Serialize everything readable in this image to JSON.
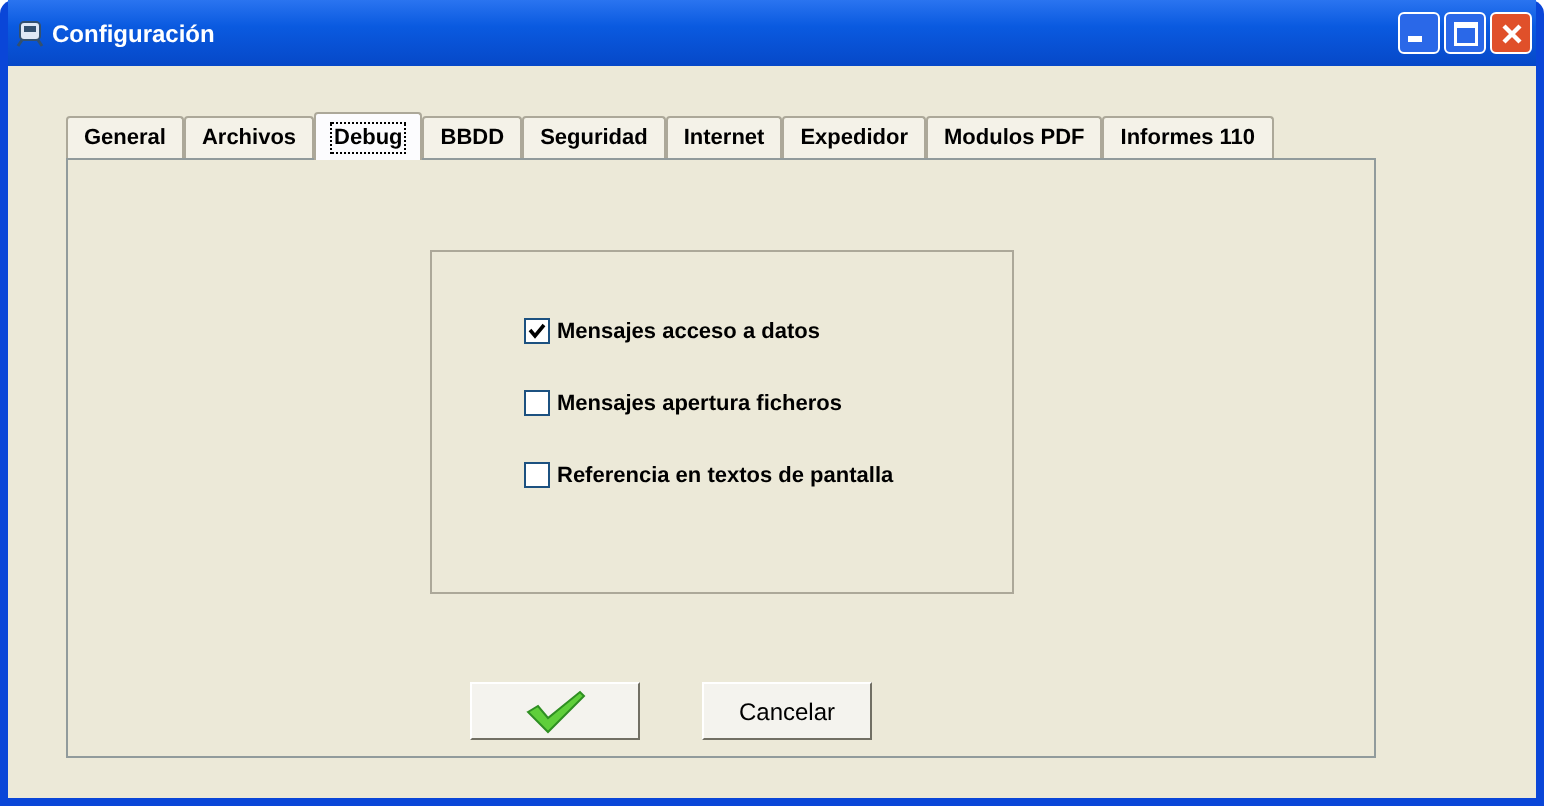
{
  "window": {
    "title": "Configuración"
  },
  "tabs": [
    {
      "label": "General",
      "selected": false
    },
    {
      "label": "Archivos",
      "selected": false
    },
    {
      "label": "Debug",
      "selected": true
    },
    {
      "label": "BBDD",
      "selected": false
    },
    {
      "label": "Seguridad",
      "selected": false
    },
    {
      "label": "Internet",
      "selected": false
    },
    {
      "label": "Expedidor",
      "selected": false
    },
    {
      "label": "Modulos PDF",
      "selected": false
    },
    {
      "label": "Informes 110",
      "selected": false
    }
  ],
  "options": [
    {
      "label": "Mensajes acceso a datos",
      "checked": true
    },
    {
      "label": "Mensajes apertura ficheros",
      "checked": false
    },
    {
      "label": "Referencia en textos de pantalla",
      "checked": false
    }
  ],
  "buttons": [
    {
      "kind": "ok"
    },
    {
      "kind": "text",
      "label": "Cancelar"
    }
  ]
}
